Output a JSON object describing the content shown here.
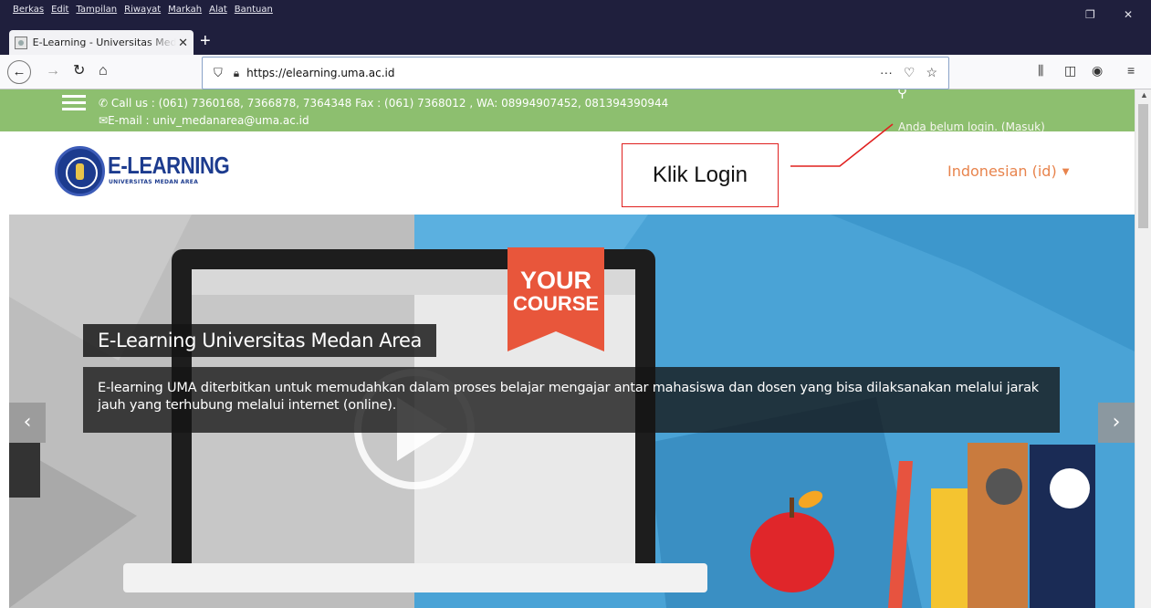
{
  "browser": {
    "menu": [
      "Berkas",
      "Edit",
      "Tampilan",
      "Riwayat",
      "Markah",
      "Alat",
      "Bantuan"
    ],
    "tab_title": "E-Learning - Universitas Medan Area",
    "url": "https://elearning.uma.ac.id",
    "icons": [
      "back-icon",
      "forward-icon",
      "reload-icon",
      "home-icon",
      "shield-icon",
      "lock-icon",
      "more-icon",
      "pocket-icon",
      "bookmark-star-icon",
      "library-icon",
      "sidebar-icon",
      "account-icon",
      "hamburger-menu-icon"
    ]
  },
  "site": {
    "contact_phone": "Call us : (061) 7360168, 7366878, 7364348 Fax : (061) 7368012 , WA: 08994907452, 081394390944",
    "contact_email": "E-mail : univ_medanarea@uma.ac.id",
    "login_status": "Anda belum login. (Masuk)",
    "logo_title": "E-LEARNING",
    "logo_subtitle": "UNIVERSITAS MEDAN AREA",
    "language": "Indonesian (id)"
  },
  "annotation": {
    "callout": "Klik Login",
    "color": "#e0201f"
  },
  "hero": {
    "title": "E-Learning Universitas Medan Area",
    "description": "E-learning UMA diterbitkan untuk memudahkan dalam proses belajar mengajar antar mahasiswa dan dosen yang bisa dilaksanakan melalui jarak jauh yang terhubung melalui internet (online).",
    "badge_line1": "YOUR",
    "badge_line2": "COURSE",
    "prev_label": "‹",
    "next_label": "›"
  },
  "colors": {
    "infobar": "#8dbf6f",
    "brand_blue": "#1c3b8e",
    "language_orange": "#e8844d",
    "hero_blue": "#4aa3d6",
    "badge_orange": "#e8563b"
  }
}
